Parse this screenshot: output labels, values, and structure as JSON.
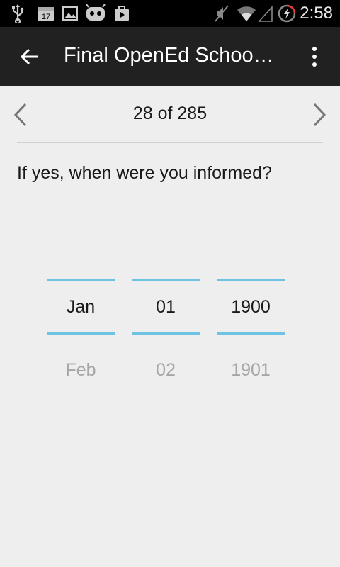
{
  "status_bar": {
    "time": "2:58",
    "icons": [
      "usb-icon",
      "calendar-notification-icon",
      "image-icon",
      "cyanogen-icon",
      "play-store-icon",
      "mute-icon",
      "wifi-icon",
      "signal-icon",
      "battery-charging-icon"
    ],
    "calendar_badge": "17"
  },
  "app_bar": {
    "title": "Final OpenEd School…",
    "back_icon": "arrow-left-icon",
    "menu_icon": "overflow-menu-icon"
  },
  "pager": {
    "count": "28 of 285",
    "prev_icon": "chevron-left-icon",
    "next_icon": "chevron-right-icon"
  },
  "question": "If yes, when were you informed?",
  "date_picker": {
    "month": {
      "selected": "Jan",
      "next": "Feb"
    },
    "day": {
      "selected": "01",
      "next": "02"
    },
    "year": {
      "selected": "1900",
      "next": "1901"
    },
    "accent_color": "#6ec3e2"
  }
}
